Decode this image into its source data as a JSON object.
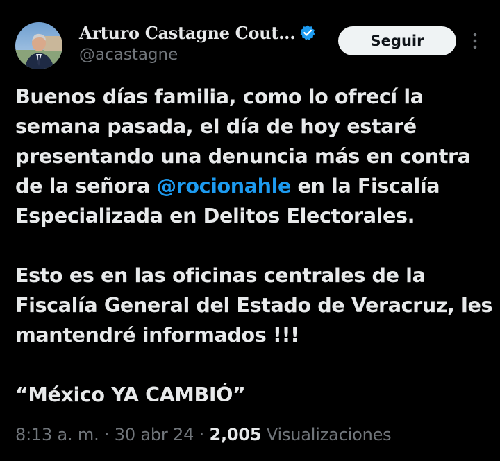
{
  "author": {
    "display_name": "Arturo Castagne Cout...",
    "handle": "@acastagne",
    "verified": true
  },
  "actions": {
    "follow_label": "Seguir"
  },
  "tweet": {
    "paragraph1_before": "Buenos días familia, como lo ofrecí la semana pasada, el día de hoy estaré presentando una denuncia más en contra de la señora ",
    "mention": "@rocionahle",
    "paragraph1_after": " en la Fiscalía Especializada en Delitos Electorales.",
    "paragraph2": "Esto es en las oficinas centrales de la Fiscalía General del Estado de Veracruz, les mantendré informados !!!",
    "paragraph3": "“México YA CAMBIÓ”"
  },
  "meta": {
    "time": "8:13 a. m.",
    "separator": " · ",
    "date": "30 abr 24",
    "views_count": "2,005",
    "views_label": " Visualizaciones"
  },
  "colors": {
    "background": "#000000",
    "text": "#e7e9ea",
    "secondary": "#71767b",
    "accent": "#1d9bf0",
    "button_bg": "#eff3f4"
  },
  "icons": [
    "verified-badge-icon",
    "more-options-icon"
  ]
}
